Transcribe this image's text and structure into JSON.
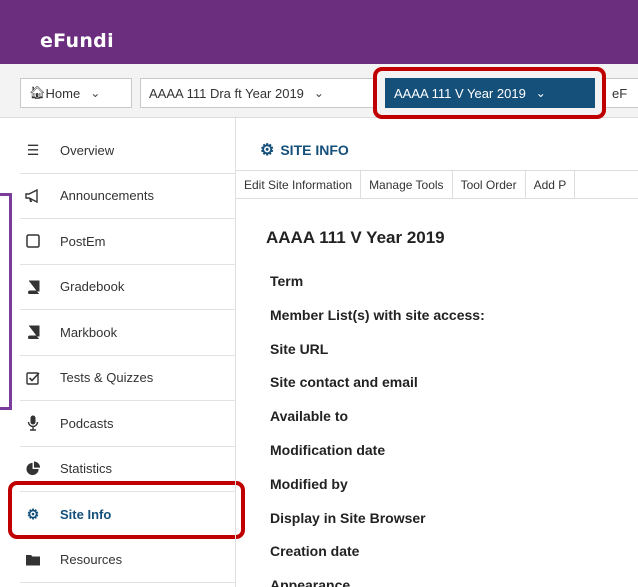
{
  "header": {
    "logo": "eFundi"
  },
  "sites": {
    "home": "Home",
    "draft": "AAAA 111 Dra ft Year 2019",
    "current": "AAAA 111 V Year 2019",
    "extra": "eF"
  },
  "sidebar": {
    "items": [
      {
        "label": "Overview",
        "icon": "list-icon"
      },
      {
        "label": "Announcements",
        "icon": "megaphone-icon"
      },
      {
        "label": "PostEm",
        "icon": "square-icon"
      },
      {
        "label": "Gradebook",
        "icon": "book-icon"
      },
      {
        "label": "Markbook",
        "icon": "book-icon"
      },
      {
        "label": "Tests & Quizzes",
        "icon": "checkbox-icon"
      },
      {
        "label": "Podcasts",
        "icon": "microphone-icon"
      },
      {
        "label": "Statistics",
        "icon": "pie-chart-icon"
      },
      {
        "label": "Site Info",
        "icon": "gear-icon",
        "active": true
      },
      {
        "label": "Resources",
        "icon": "folder-icon"
      }
    ]
  },
  "main": {
    "section_title": "SITE INFO",
    "toolbar": [
      "Edit Site Information",
      "Manage Tools",
      "Tool Order",
      "Add P"
    ],
    "site_title": "AAAA 111 V Year 2019",
    "fields": [
      "Term",
      "Member List(s) with site access:",
      "Site URL",
      "Site contact and email",
      "Available to",
      "Modification date",
      "Modified by",
      "Display in Site Browser",
      "Creation date",
      "Appearance"
    ]
  },
  "colors": {
    "header_bg": "#6b2d7e",
    "selected_site_bg": "#15507b",
    "highlight_box": "#c00000",
    "accent_link": "#15507b"
  }
}
